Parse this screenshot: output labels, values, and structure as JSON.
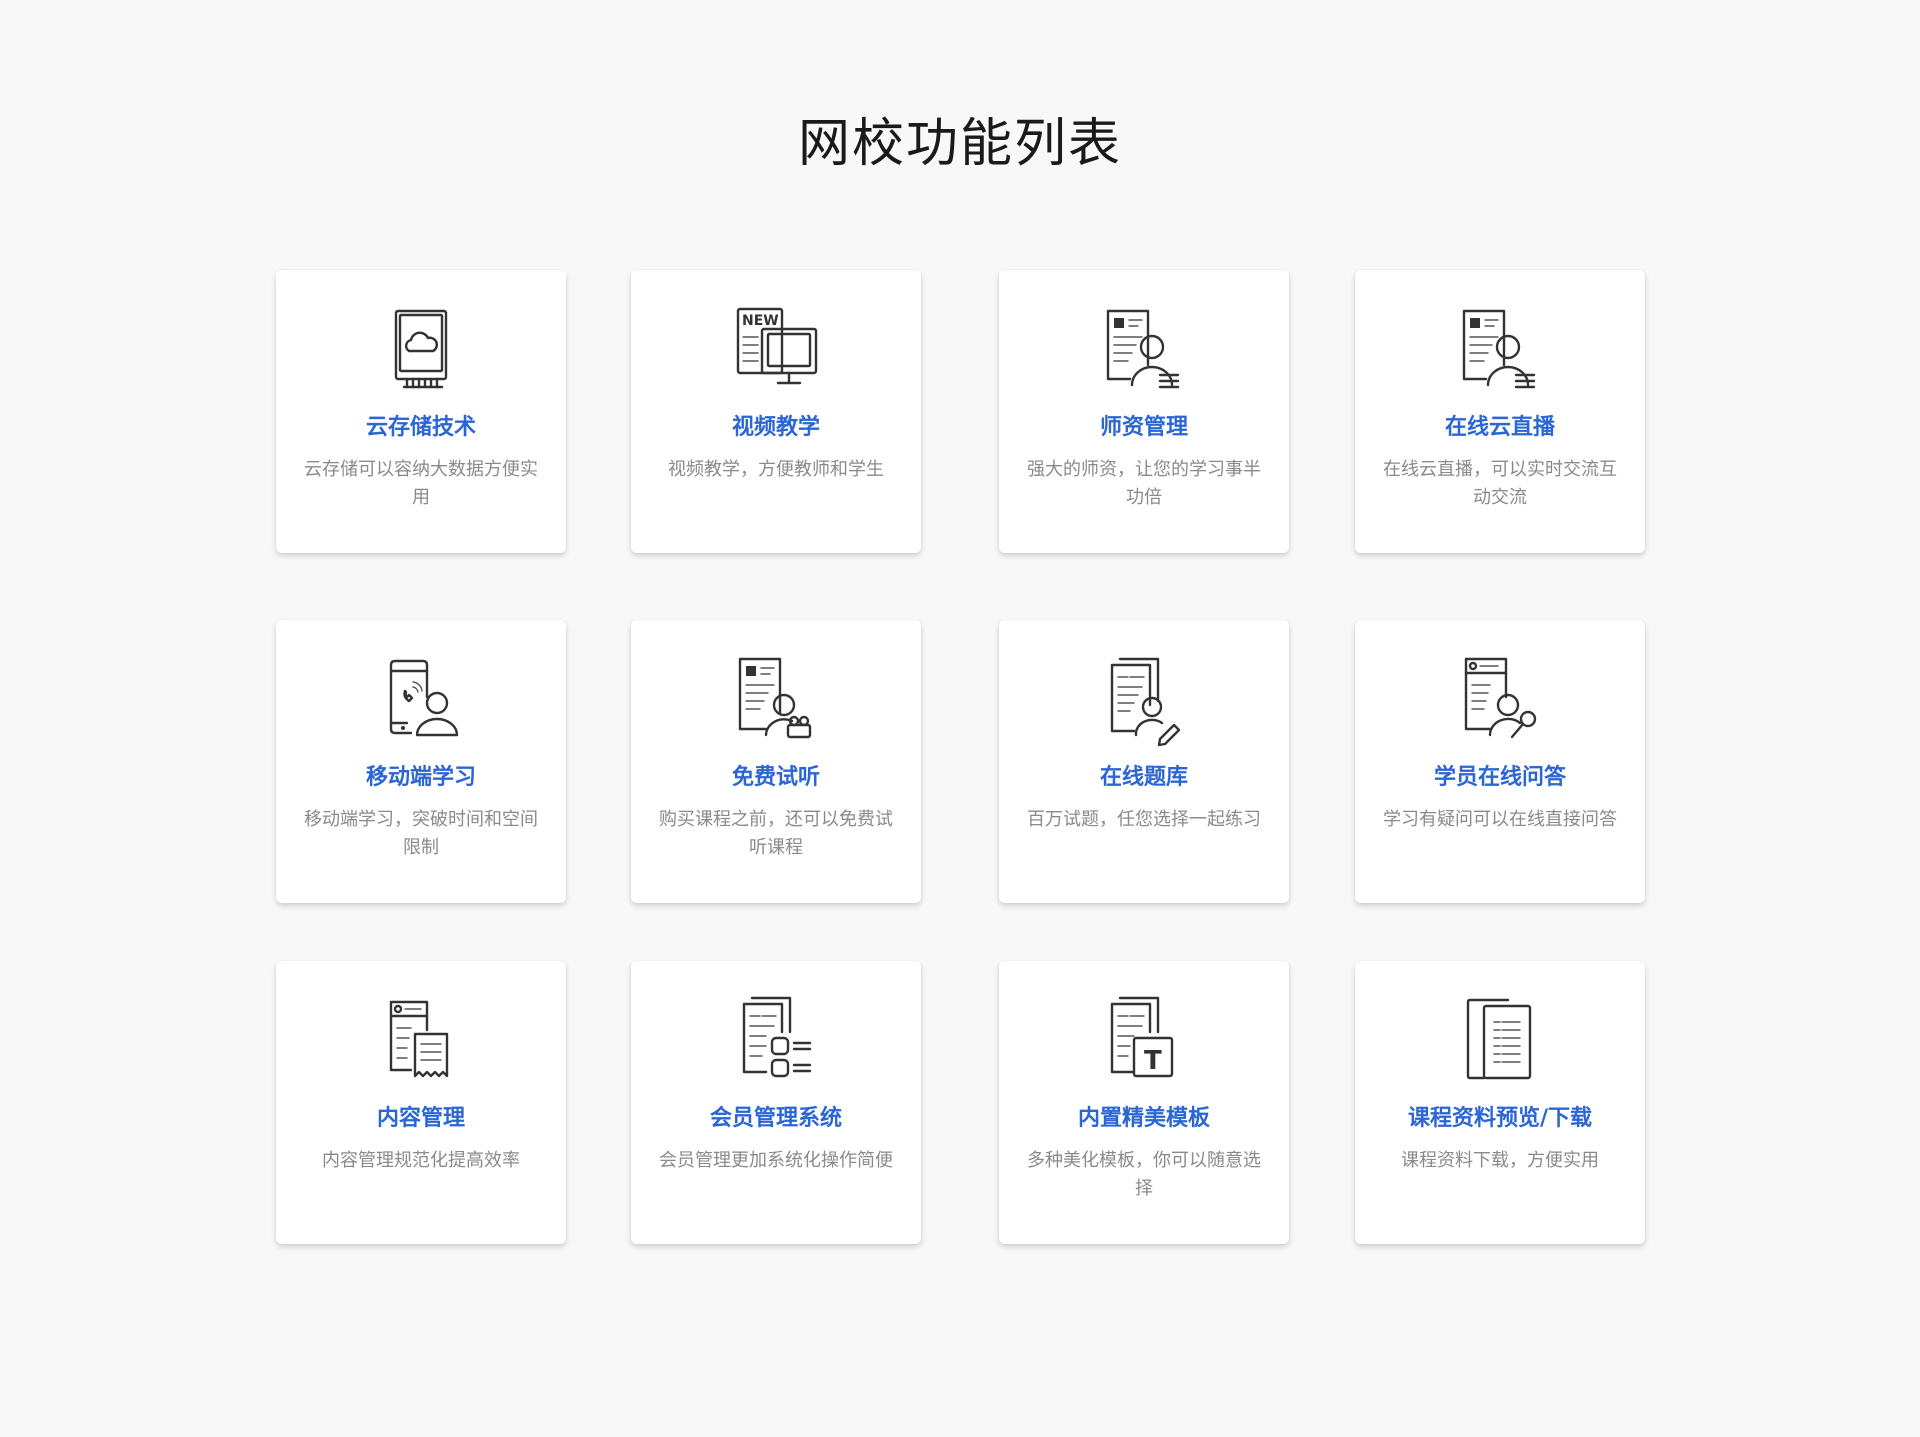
{
  "page": {
    "title": "网校功能列表"
  },
  "cards": [
    {
      "title": "云存储技术",
      "desc": "云存储可以容纳大数据方便实用",
      "icon": "cloud-storage-icon"
    },
    {
      "title": "视频教学",
      "desc": "视频教学，方便教师和学生",
      "icon": "new-video-monitor-icon"
    },
    {
      "title": "师资管理",
      "desc": "强大的师资，让您的学习事半功倍",
      "icon": "teacher-profile-icon"
    },
    {
      "title": "在线云直播",
      "desc": "在线云直播，可以实时交流互动交流",
      "icon": "live-broadcast-profile-icon"
    },
    {
      "title": "移动端学习",
      "desc": "移动端学习，突破时间和空间限制",
      "icon": "mobile-learning-icon"
    },
    {
      "title": "免费试听",
      "desc": "购买课程之前，还可以免费试听课程",
      "icon": "free-trial-camera-icon"
    },
    {
      "title": "在线题库",
      "desc": "百万试题，任您选择一起练习",
      "icon": "question-bank-pencil-icon"
    },
    {
      "title": "学员在线问答",
      "desc": "学习有疑问可以在线直接问答",
      "icon": "student-qa-search-icon"
    },
    {
      "title": "内容管理",
      "desc": "内容管理规范化提高效率",
      "icon": "content-management-icon"
    },
    {
      "title": "会员管理系统",
      "desc": "会员管理更加系统化操作简便",
      "icon": "member-system-icon"
    },
    {
      "title": "内置精美模板",
      "desc": "多种美化模板，你可以随意选择",
      "icon": "template-text-icon"
    },
    {
      "title": "课程资料预览/下载",
      "desc": "课程资料下载，方便实用",
      "icon": "course-documents-icon"
    }
  ]
}
